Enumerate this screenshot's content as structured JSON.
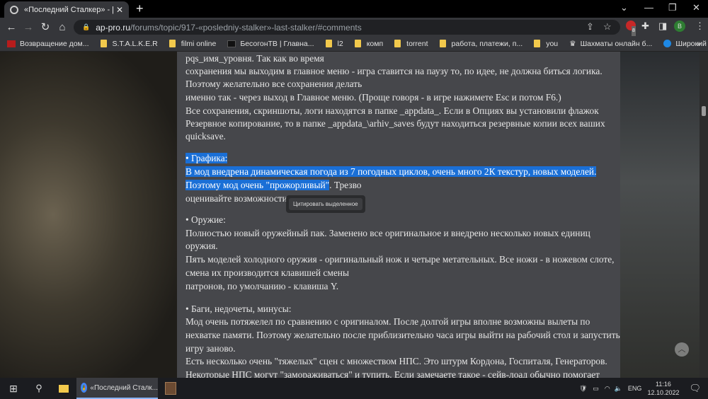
{
  "browser": {
    "tab_title": "«Последний Сталкер» - [Last Sta",
    "url_host": "ap-pro.ru",
    "url_path": "/forums/topic/917-«posledniy-stalker»-last-stalker/#comments",
    "ext_badge": "8",
    "profile_initial": "B",
    "bookmarks": [
      "Возвращение дом...",
      "S.T.A.L.K.E.R",
      "filmi online",
      "БесогонТВ | Главна...",
      "l2",
      "комп",
      "torrent",
      "работа, платежи, п...",
      "you",
      "Шахматы онлайн б...",
      "Широкий выбор к..."
    ],
    "bookmarks_more": "»"
  },
  "content": {
    "lines1": [
      "pqs_имя_уровня. Так как во время",
      "сохранения мы выходим в главное меню - игра ставится на паузу то, по идее, не должна биться логика.",
      "Поэтому желательно все сохранения делать",
      "именно так - через выход в Главное меню. (Проще говоря - в игре нажимете Esc и потом F6.)",
      "Все сохранения, скриншоты, логи находятся в папке _appdata_. Если в Опциях вы установили флажок",
      "Резервное копирование, то в папке _appdata_\\arhiv_saves будут находиться резервные копии всех ваших",
      "quicksave."
    ],
    "graphics_heading": "• Графика:",
    "graphics_line1": "В мод внедрена динамическая погода из 7 погодных циклов, очень много 2К текстур, новых моделей.",
    "graphics_line2_selected": "Поэтому мод очень \"прожорливый\"",
    "graphics_line2_rest": ". Трезво",
    "graphics_line3": "оценивайте возможности",
    "quote_button": "Цитировать выделенное",
    "lines3": [
      "• Оружие:",
      "Полностью новый оружейный пак. Заменено все оригинальное и внедрено несколько новых единиц",
      "оружия.",
      "Пять моделей холодного оружия - оригинальный нож и четыре метательных. Все ножи - в ножевом слоте,",
      "смена их производится клавишей смены",
      "патронов, по умолчанию - клавиша Y."
    ],
    "lines4": [
      "• Баги, недочеты, минусы:",
      "Мод очень потяжелел по сравнению с оригиналом. После долгой игры вполне возможны вылеты по",
      "нехватке памяти. Поэтому желательно после приблизительно часа игры выйти на рабочий стол и запустить",
      "игру заново.",
      "Есть несколько очень \"тяжелых\" сцен с множеством НПС. Это штурм Кордона, Госпиталя, Генераторов.",
      "Некоторые НПС могут \"замораживаться\" и тупить. Если замечаете такое - сейв-лоад обычно помогает"
    ]
  },
  "taskbar": {
    "chrome_label": "«Последний Сталк...",
    "lang": "ENG",
    "time": "11:16",
    "date": "12.10.2022"
  }
}
